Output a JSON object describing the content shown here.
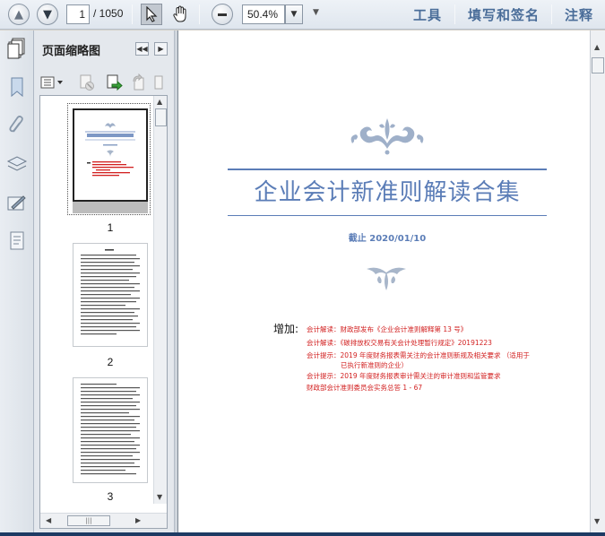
{
  "toolbar": {
    "page_current": "1",
    "page_total": "/ 1050",
    "zoom_value": "50.4%",
    "menu_tools": "工具",
    "menu_sign": "填写和签名",
    "menu_comment": "注释"
  },
  "panel": {
    "title": "页面缩略图",
    "thumbnails": [
      {
        "label": "1"
      },
      {
        "label": "2"
      },
      {
        "label": "3"
      }
    ]
  },
  "document": {
    "title": "企业会计新准则解读合集",
    "date": "截止 2020/01/10",
    "add_label": "增加:",
    "added_items": [
      "会计解读：财政部发布《企业会计准则解释第 13 号》",
      "会计解读：《碳排放权交易有关会计处理暂行规定》20191223",
      "会计提示：2019 年度财务报表需关注的会计准则新规及相关要求 （适用于",
      "已执行新准则的企业）",
      "会计提示：2019 年度财务报表审计需关注的审计准则和监管要求",
      "财政部会计准则委员会实务总答 1 - 67"
    ]
  },
  "colors": {
    "accent_blue": "#5b7db7",
    "red_text": "#d22020",
    "menu_blue": "#4a6d99"
  }
}
